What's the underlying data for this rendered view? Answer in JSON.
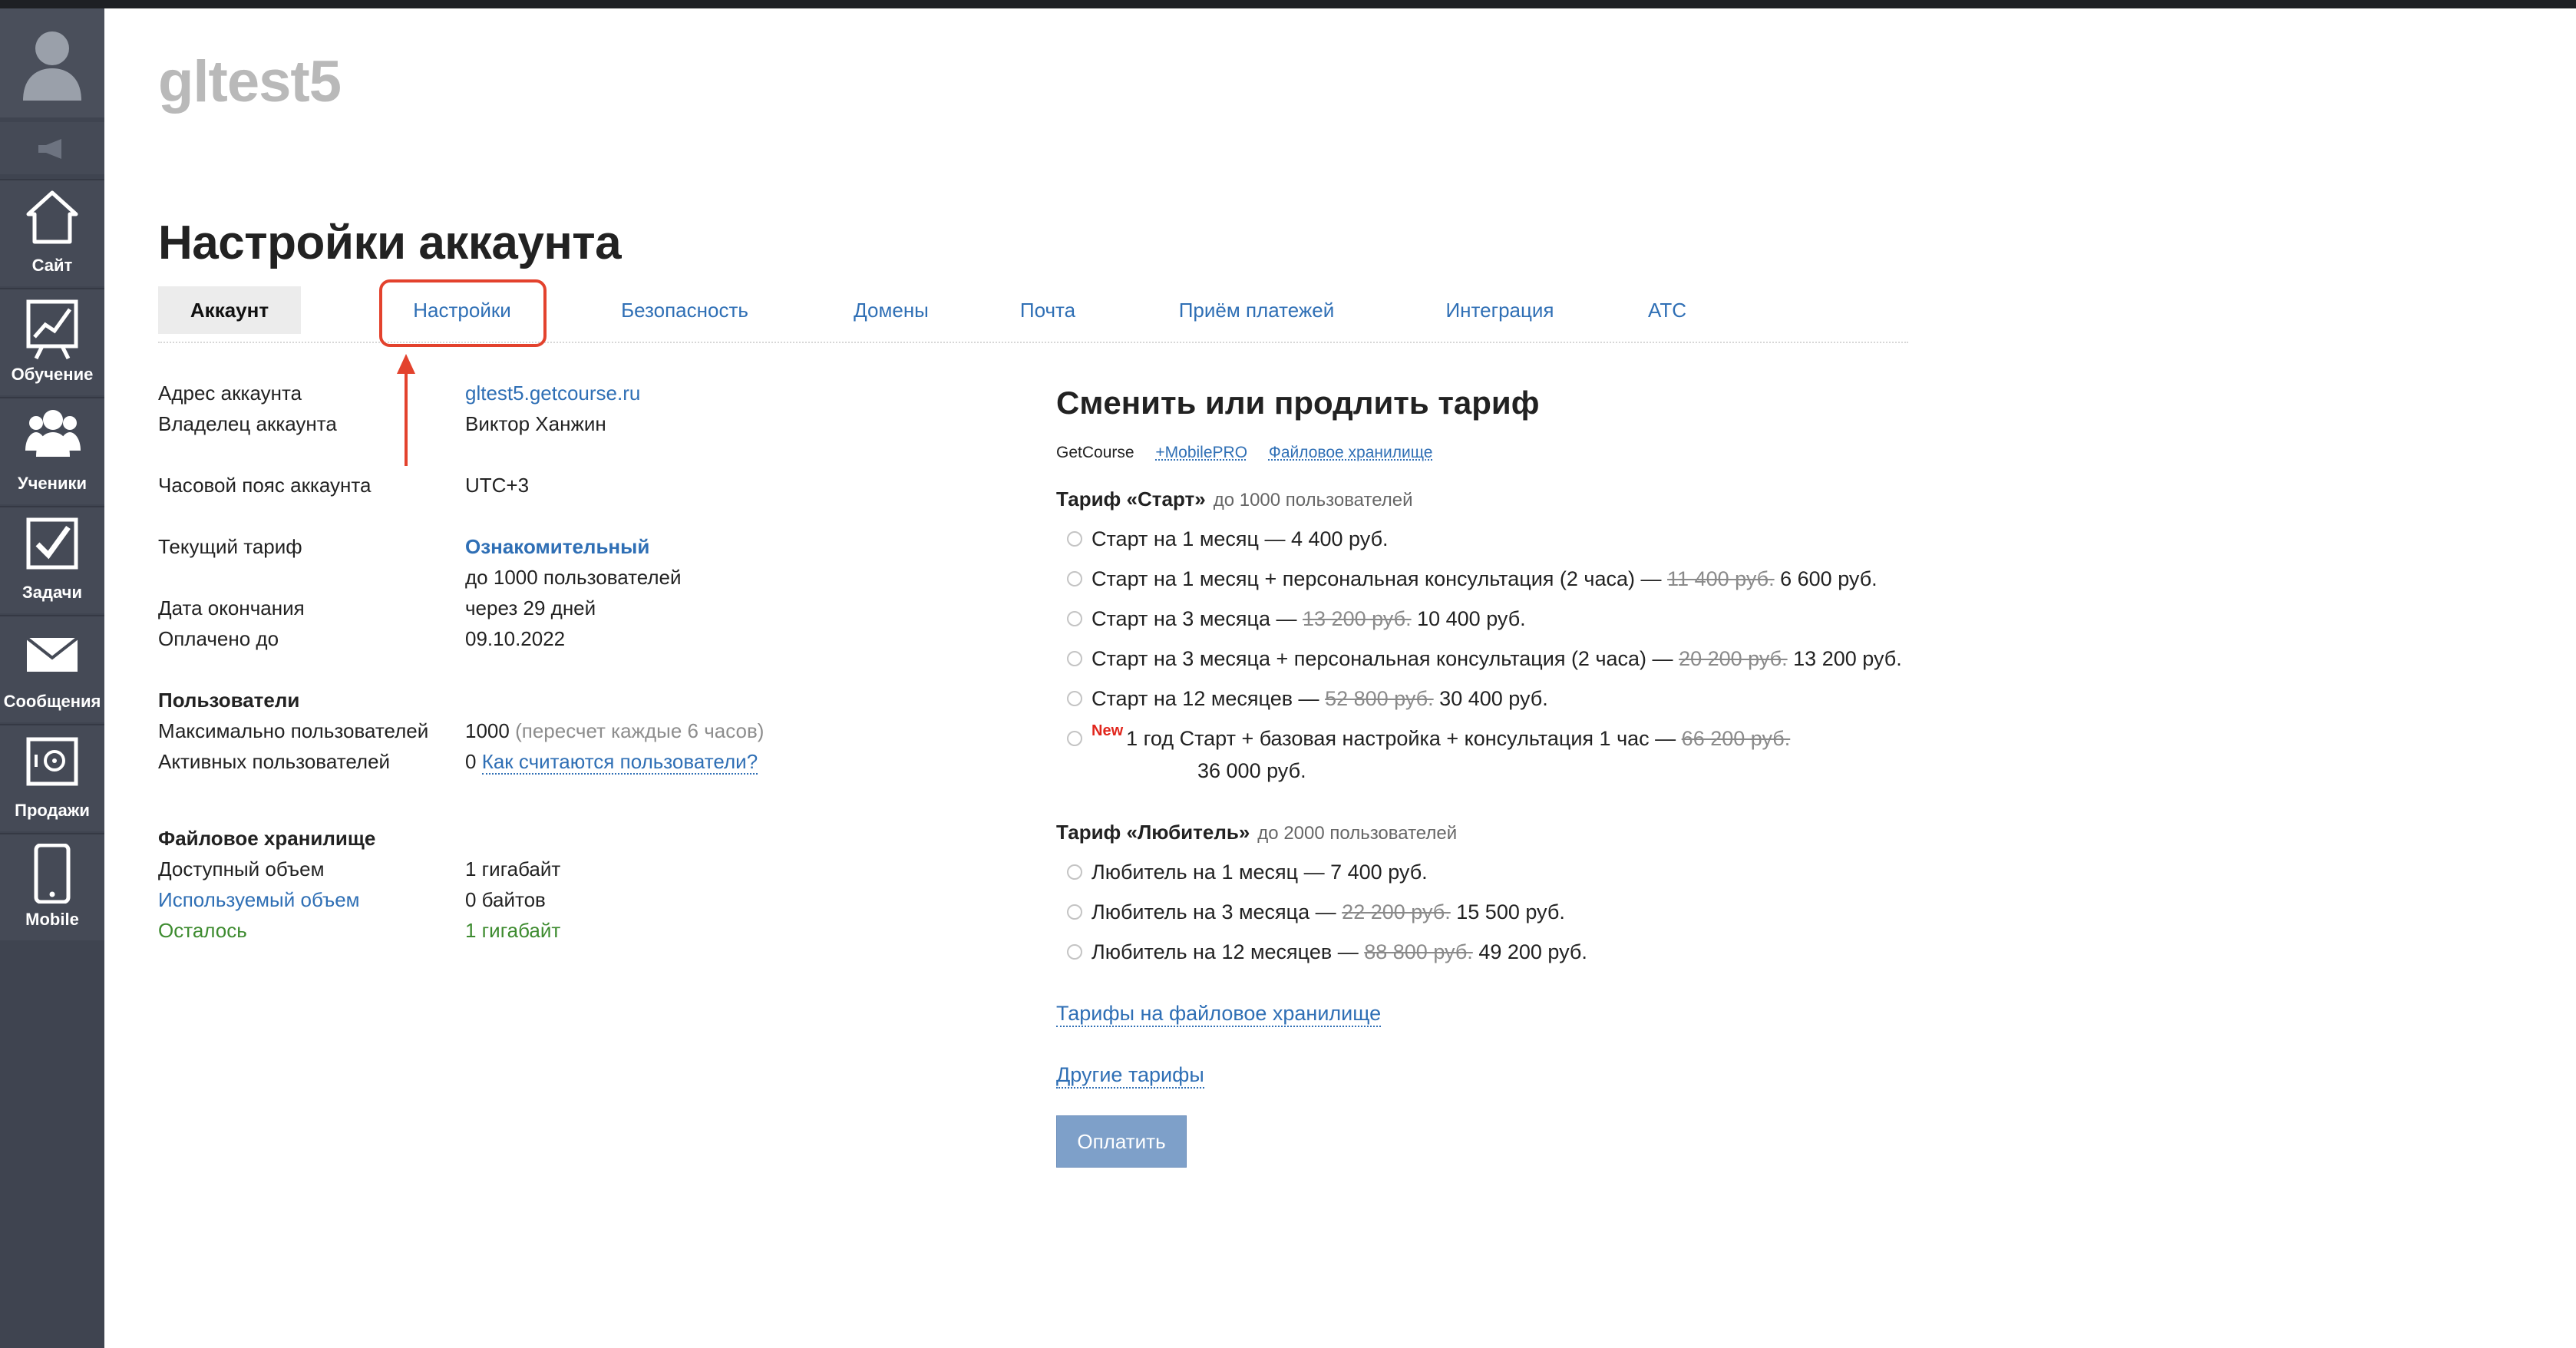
{
  "site": {
    "name": "gltest5"
  },
  "sidebar": {
    "items": [
      {
        "label": "Сайт",
        "icon": "home-icon"
      },
      {
        "label": "Обучение",
        "icon": "chart-icon"
      },
      {
        "label": "Ученики",
        "icon": "users-icon"
      },
      {
        "label": "Задачи",
        "icon": "checkbox-icon"
      },
      {
        "label": "Сообщения",
        "icon": "envelope-icon"
      },
      {
        "label": "Продажи",
        "icon": "safe-icon"
      },
      {
        "label": "Mobile",
        "icon": "phone-icon"
      }
    ]
  },
  "page": {
    "title": "Настройки аккаунта"
  },
  "tabs": [
    {
      "label": "Аккаунт",
      "active": true
    },
    {
      "label": "Настройки",
      "highlighted": true
    },
    {
      "label": "Безопасность"
    },
    {
      "label": "Домены"
    },
    {
      "label": "Почта"
    },
    {
      "label": "Приём платежей"
    },
    {
      "label": "Интеграция"
    },
    {
      "label": "АТС"
    }
  ],
  "account": {
    "address_label": "Адрес аккаунта",
    "address_value": "gltest5.getcourse.ru",
    "owner_label": "Владелец аккаунта",
    "owner_value": "Виктор Ханжин",
    "timezone_label": "Часовой пояс аккаунта",
    "timezone_value": "UTC+3",
    "tariff_label": "Текущий тариф",
    "tariff_value": "Ознакомительный",
    "tariff_users": "до 1000 пользователей",
    "end_label": "Дата окончания",
    "end_value": "через 29 дней",
    "paid_label": "Оплачено до",
    "paid_value": "09.10.2022"
  },
  "users": {
    "heading": "Пользователи",
    "max_label": "Максимально пользователей",
    "max_value": "1000",
    "max_note": "(пересчет каждые 6 часов)",
    "active_label": "Активных пользователей",
    "active_value": "0",
    "active_link": "Как считаются пользователи?"
  },
  "storage": {
    "heading": "Файловое хранилище",
    "available_label": "Доступный объем",
    "available_value": "1 гигабайт",
    "used_label": "Используемый объем",
    "used_value": "0 байтов",
    "left_label": "Осталось",
    "left_value": "1 гигабайт"
  },
  "tariffs": {
    "title": "Сменить или продлить тариф",
    "categories": [
      "GetCourse",
      "+MobilePRO",
      "Файловое хранилище"
    ],
    "start": {
      "name": "Тариф «Старт»",
      "sub": "до 1000 пользователей",
      "options": [
        {
          "text": "Старт на 1 месяц — 4 400 руб.",
          "old": "",
          "price": ""
        },
        {
          "text": "Старт на 1 месяц + персональная консультация (2 часа) —",
          "old": "11 400 руб.",
          "price": "6 600 руб."
        },
        {
          "text": "Старт на 3 месяца —",
          "old": "13 200 руб.",
          "price": "10 400 руб."
        },
        {
          "text": "Старт на 3 месяца + персональная консультация (2 часа) —",
          "old": "20 200 руб.",
          "price": "13 200 руб."
        },
        {
          "text": "Старт на 12 месяцев —",
          "old": "52 800 руб.",
          "price": "30 400 руб."
        }
      ],
      "special": {
        "badge": "New",
        "text": "1 год Старт + базовая настройка + консультация 1 час —",
        "old": "66 200 руб.",
        "price": "36 000 руб."
      }
    },
    "amateur": {
      "name": "Тариф «Любитель»",
      "sub": "до 2000 пользователей",
      "options": [
        {
          "text": "Любитель на 1 месяц — 7 400 руб.",
          "old": "",
          "price": ""
        },
        {
          "text": "Любитель на 3 месяца —",
          "old": "22 200 руб.",
          "price": "15 500 руб."
        },
        {
          "text": "Любитель на 12 месяцев —",
          "old": "88 800 руб.",
          "price": "49 200 руб."
        }
      ]
    },
    "storage_link": "Тарифы на файловое хранилище",
    "other_link": "Другие тарифы",
    "pay_button": "Оплатить"
  },
  "colors": {
    "accent": "#2f6fb5",
    "highlight": "#e3422d",
    "sidebar": "#3f4450",
    "new": "#e1261d"
  }
}
